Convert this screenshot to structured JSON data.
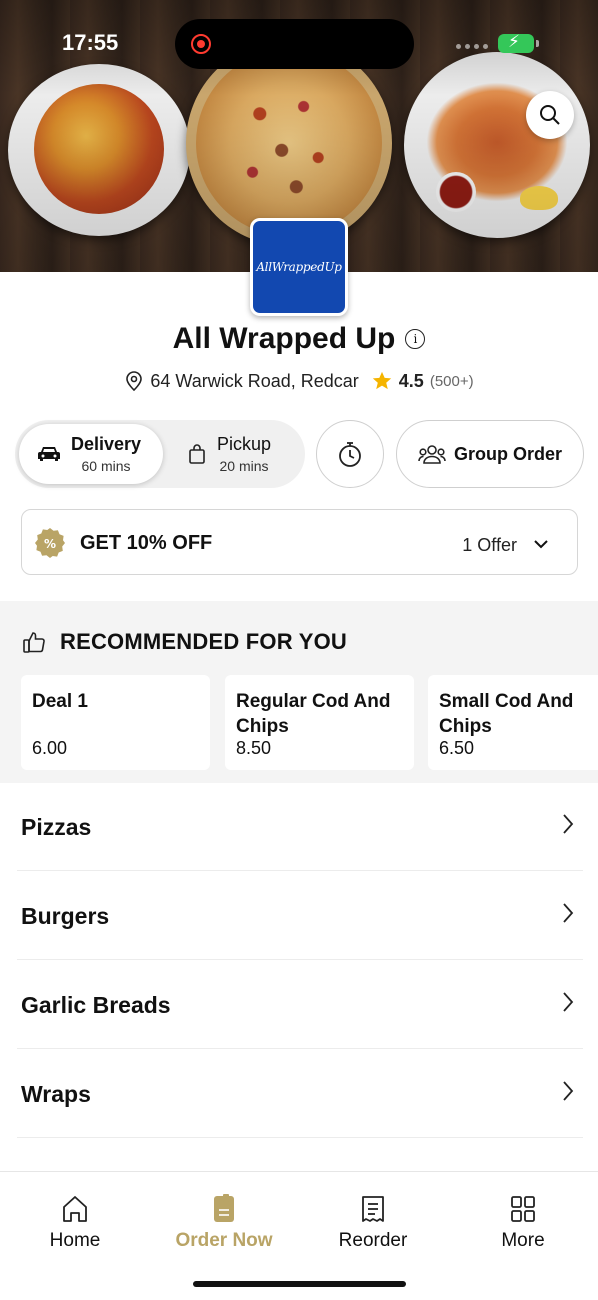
{
  "status_bar": {
    "time": "17:55"
  },
  "store": {
    "logo_text": "AllWrappedUp",
    "name": "All Wrapped Up",
    "address": "64 Warwick Road, Redcar",
    "rating": "4.5",
    "rating_count": "(500+)"
  },
  "mode": {
    "delivery_label": "Delivery",
    "delivery_time": "60 mins",
    "pickup_label": "Pickup",
    "pickup_time": "20 mins",
    "group_order_label": "Group Order"
  },
  "offer": {
    "title": "GET 10% OFF",
    "count": "1 Offer"
  },
  "recommended": {
    "title": "RECOMMENDED FOR YOU",
    "items": [
      {
        "name": "Deal 1",
        "price": "6.00"
      },
      {
        "name": "Regular Cod And Chips",
        "price": "8.50"
      },
      {
        "name": "Small Cod And Chips",
        "price": "6.50"
      }
    ]
  },
  "categories": [
    "Pizzas",
    "Burgers",
    "Garlic Breads",
    "Wraps"
  ],
  "tabbar": {
    "home": "Home",
    "order_now": "Order Now",
    "reorder": "Reorder",
    "more": "More"
  },
  "colors": {
    "accent": "#b9a466",
    "logo_bg": "#1248b0",
    "rating_star": "#f5b400",
    "battery": "#34c759"
  },
  "icons": [
    "search-icon",
    "info-icon",
    "location-pin-icon",
    "star-icon",
    "car-icon",
    "bag-icon",
    "stopwatch-icon",
    "group-icon",
    "discount-badge-icon",
    "chevron-down-icon",
    "thumbs-up-icon",
    "chevron-right-icon",
    "home-icon",
    "order-now-icon",
    "receipt-icon",
    "grid-icon"
  ]
}
